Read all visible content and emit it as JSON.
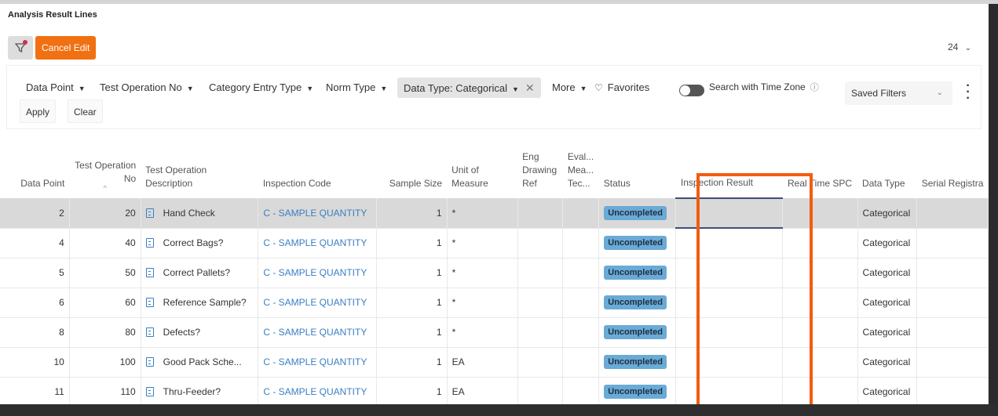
{
  "title": "Analysis Result Lines",
  "toolbar": {
    "cancel_edit": "Cancel Edit",
    "page_size": "24"
  },
  "filters": {
    "items": [
      "Data Point",
      "Test Operation No",
      "Category Entry Type",
      "Norm Type"
    ],
    "active_chip": "Data Type: Categorical",
    "more": "More",
    "favorites": "Favorites",
    "time_zone": "Search with Time Zone",
    "saved_filters": "Saved Filters",
    "apply": "Apply",
    "clear": "Clear"
  },
  "table": {
    "headers": [
      "Data Point",
      "Test Operation No",
      "Test Operation Description",
      "Inspection Code",
      "Sample Size",
      "Unit of Measure",
      "Eng Drawing Ref",
      "Eval... Mea... Tec...",
      "Status",
      "Inspection Result",
      "Real Time SPC",
      "Data Type",
      "Serial Registra"
    ],
    "rows": [
      {
        "dp": "2",
        "no": "20",
        "desc": "Hand Check",
        "code": "C - SAMPLE QUANTITY",
        "size": "1",
        "uom": "*",
        "status": "Uncompleted",
        "type": "Categorical"
      },
      {
        "dp": "4",
        "no": "40",
        "desc": "Correct Bags?",
        "code": "C - SAMPLE QUANTITY",
        "size": "1",
        "uom": "*",
        "status": "Uncompleted",
        "type": "Categorical"
      },
      {
        "dp": "5",
        "no": "50",
        "desc": "Correct Pallets?",
        "code": "C - SAMPLE QUANTITY",
        "size": "1",
        "uom": "*",
        "status": "Uncompleted",
        "type": "Categorical"
      },
      {
        "dp": "6",
        "no": "60",
        "desc": "Reference Sample?",
        "code": "C - SAMPLE QUANTITY",
        "size": "1",
        "uom": "*",
        "status": "Uncompleted",
        "type": "Categorical"
      },
      {
        "dp": "8",
        "no": "80",
        "desc": "Defects?",
        "code": "C - SAMPLE QUANTITY",
        "size": "1",
        "uom": "*",
        "status": "Uncompleted",
        "type": "Categorical"
      },
      {
        "dp": "10",
        "no": "100",
        "desc": "Good Pack Sche...",
        "code": "C - SAMPLE QUANTITY",
        "size": "1",
        "uom": "EA",
        "status": "Uncompleted",
        "type": "Categorical"
      },
      {
        "dp": "11",
        "no": "110",
        "desc": "Thru-Feeder?",
        "code": "C - SAMPLE QUANTITY",
        "size": "1",
        "uom": "EA",
        "status": "Uncompleted",
        "type": "Categorical"
      }
    ]
  },
  "colors": {
    "accent": "#f07012",
    "highlight": "#f25c10",
    "badge": "#6aaad6",
    "link": "#3a7fc4"
  }
}
